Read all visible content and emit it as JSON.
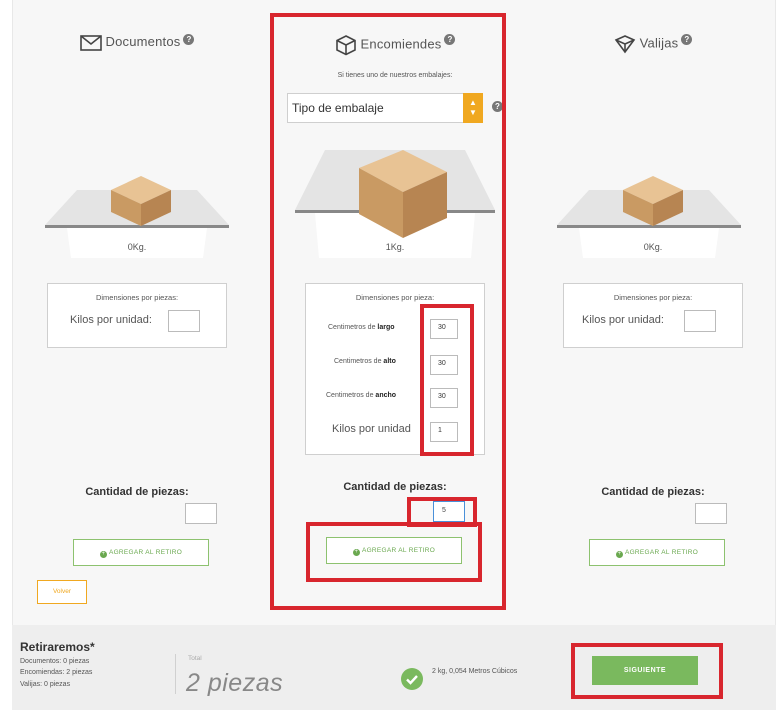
{
  "columns": {
    "documentos": {
      "title": "Documentos",
      "weight": "0Kg.",
      "dim_title": "Dimensiones por piezas:",
      "kilos_label": "Kilos por unidad:",
      "qty_label": "Cantidad de piezas:",
      "qty_value": "",
      "add_label": "AGREGAR AL RETIRO"
    },
    "encomiendas": {
      "title": "Encomiendes",
      "package_note": "Si tienes uno de nuestros embalajes:",
      "package_select": "Tipo de embalaje",
      "weight": "1Kg.",
      "dim_title": "Dimensiones por pieza:",
      "largo_prefix": "Centimetros de ",
      "largo_bold": "largo",
      "largo_value": "30",
      "alto_prefix": "Centimetros de ",
      "alto_bold": "alto",
      "alto_value": "30",
      "ancho_prefix": "Centimetros de ",
      "ancho_bold": "ancho",
      "ancho_value": "30",
      "kilos_label": "Kilos por unidad",
      "kilos_value": "1",
      "qty_label": "Cantidad de piezas:",
      "qty_value": "5",
      "add_label": "AGREGAR AL RETIRO"
    },
    "valijas": {
      "title": "Valijas",
      "weight": "0Kg.",
      "dim_title": "Dimensiones por pieza:",
      "kilos_label": "Kilos por unidad:",
      "qty_label": "Cantidad de piezas:",
      "qty_value": "",
      "add_label": "AGREGAR AL RETIRO"
    }
  },
  "volver_label": "Volver",
  "footer": {
    "title": "Retiraremos*",
    "documentos": "Documentos: 0 piezas",
    "encomiendas": "Encomiendas: 2 piezas",
    "valijas": "Valijas: 0 piezas",
    "total_label": "Total",
    "total_value": "2 piezas",
    "summary": "2 kg, 0,054 Metros Cúbicos",
    "next_label": "SIGUIENTE"
  },
  "colors": {
    "accent_green": "#7ab95e",
    "accent_orange": "#f0a820",
    "highlight_red": "#d8262e"
  }
}
